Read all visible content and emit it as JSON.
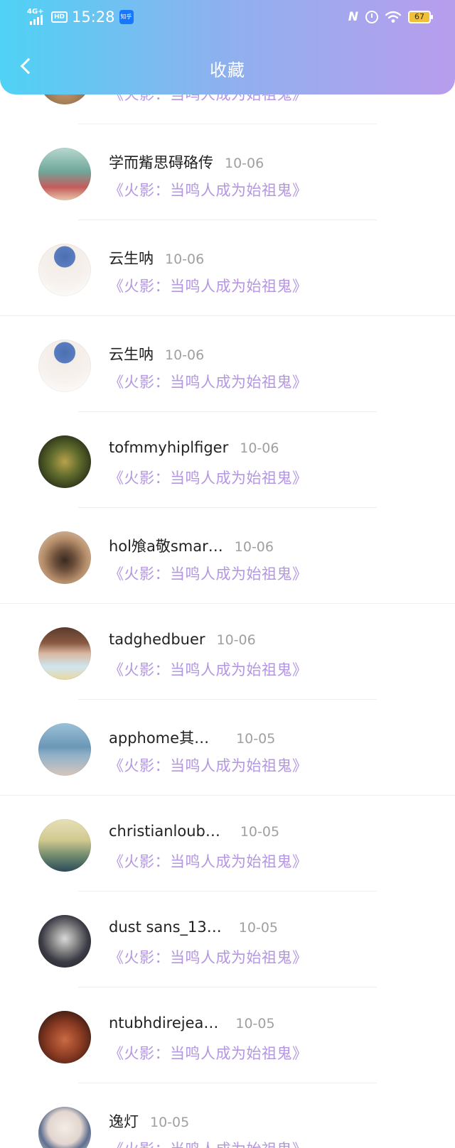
{
  "status_bar": {
    "network": "4G+",
    "hd": "HD",
    "time": "15:28",
    "app_badge": "知乎",
    "battery": "67"
  },
  "header": {
    "title": "收藏"
  },
  "colors": {
    "header_gradient_start": "#4fd2f5",
    "header_gradient_end": "#b89ded",
    "book_title": "#b497e0",
    "date": "#a0a0a0"
  },
  "items": [
    {
      "name": "",
      "date": "",
      "book": "《火影：当鸣人成为始祖鬼》"
    },
    {
      "name": "学而觜思碍硌传",
      "date": "10-06",
      "book": "《火影：当鸣人成为始祖鬼》"
    },
    {
      "name": "云生呐",
      "date": "10-06",
      "book": "《火影：当鸣人成为始祖鬼》"
    },
    {
      "name": "云生呐",
      "date": "10-06",
      "book": "《火影：当鸣人成为始祖鬼》"
    },
    {
      "name": "tofmmyhiplfiger",
      "date": "10-06",
      "book": "《火影：当鸣人成为始祖鬼》"
    },
    {
      "name": "hol飧a敬smar…",
      "date": "10-06",
      "book": "《火影：当鸣人成为始祖鬼》"
    },
    {
      "name": "tadghedbuer",
      "date": "10-06",
      "book": "《火影：当鸣人成为始祖鬼》"
    },
    {
      "name": "apphome其…",
      "date": "10-05",
      "book": "《火影：当鸣人成为始祖鬼》"
    },
    {
      "name": "christianloub…",
      "date": "10-05",
      "book": "《火影：当鸣人成为始祖鬼》"
    },
    {
      "name": "dust sans_13…",
      "date": "10-05",
      "book": "《火影：当鸣人成为始祖鬼》"
    },
    {
      "name": "ntubhdirejea…",
      "date": "10-05",
      "book": "《火影：当鸣人成为始祖鬼》"
    },
    {
      "name": "逸灯",
      "date": "10-05",
      "book": "《火影：当鸣人成为始祖鬼》"
    }
  ]
}
